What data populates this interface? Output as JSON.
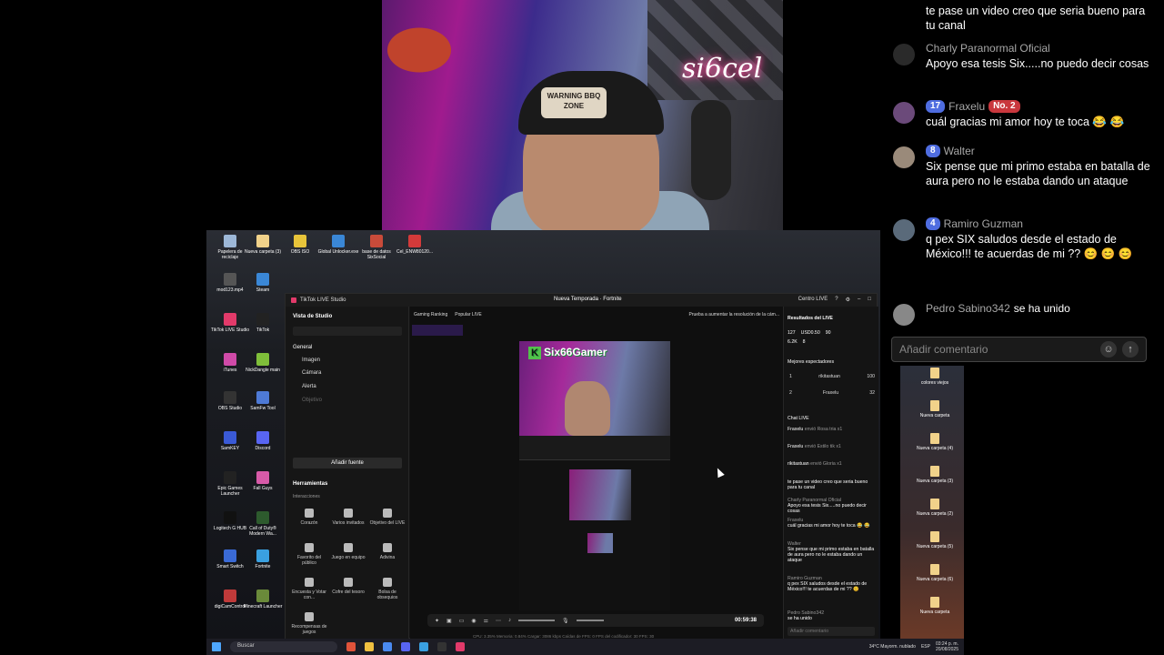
{
  "webcam": {
    "cap_text": "WARNING BBQ ZONE",
    "neon_text": "si6cel"
  },
  "chat_overlay": {
    "top_partial": "te pase un video creo que seria bueno para tu canal",
    "messages": [
      {
        "name": "Charly Paranormal Oficial",
        "text": "Apoyo esa tesis Six.....no puedo decir cosas",
        "badges": []
      },
      {
        "name": "Fraxelu",
        "badge_num": "17",
        "badge_rank": "No. 2",
        "text": "cuál gracias mi amor hoy te toca 😂 😂"
      },
      {
        "name": "Walter",
        "badge_num": "8",
        "text": "Six pense que mi primo estaba en batalla de aura pero no le estaba dando un ataque"
      },
      {
        "name": "Ramiro Guzman",
        "badge_num": "4",
        "text": "q pex SIX saludos desde el estado de México!!! te acuerdas de mi ?? 😊 😊 😊"
      }
    ],
    "join_notice": {
      "name": "Pedro Sabino342",
      "text": "se ha unido"
    },
    "comment_placeholder": "Añadir comentario"
  },
  "desktop_icons": [
    {
      "label": "Papelera de reciclaje",
      "color": "#9db8d8"
    },
    {
      "label": "Nueva carpeta (3)",
      "color": "#f1d28a"
    },
    {
      "label": "OBS ISO",
      "color": "#e8c43a"
    },
    {
      "label": "Global Unlocker.exe",
      "color": "#3a87d6"
    },
    {
      "label": "base de datos SixSocial",
      "color": "#c94b3a"
    },
    {
      "label": "Cel_ENW80120...",
      "color": "#d43a3a"
    },
    {
      "label": "mod123.mp4",
      "color": "#555"
    },
    {
      "label": "Steam",
      "color": "#3a87d6"
    },
    {
      "label": "TikTok LIVE Studio",
      "color": "#e23a6a"
    },
    {
      "label": "TikTok",
      "color": "#222"
    },
    {
      "label": "iTunes",
      "color": "#d04aa8"
    },
    {
      "label": "NickDangle main",
      "color": "#7fbf3a"
    },
    {
      "label": "OBS Studio",
      "color": "#333"
    },
    {
      "label": "SamFw Tool",
      "color": "#4e7ad6"
    },
    {
      "label": "SamKEY",
      "color": "#3a5ad6"
    },
    {
      "label": "Discord",
      "color": "#5865f2"
    },
    {
      "label": "Epic Games Launcher",
      "color": "#222"
    },
    {
      "label": "Fall Guys",
      "color": "#d75aa8"
    },
    {
      "label": "Logitech G HUB",
      "color": "#111"
    },
    {
      "label": "Call of Duty® Modern Wa...",
      "color": "#2d5a2d"
    },
    {
      "label": "Smart Switch",
      "color": "#3a6ad6"
    },
    {
      "label": "Fortnite",
      "color": "#3aa0e0"
    },
    {
      "label": "digiCamControl",
      "color": "#c03a3a"
    },
    {
      "label": "Minecraft Launcher",
      "color": "#6a8a3a"
    }
  ],
  "desktop_right_icons": [
    {
      "label": "colores viejos"
    },
    {
      "label": "Nueva carpeta"
    },
    {
      "label": "Nueva carpeta (4)"
    },
    {
      "label": "Nueva carpeta (3)"
    },
    {
      "label": "Nueva carpeta (2)"
    },
    {
      "label": "Nueva carpeta (5)"
    },
    {
      "label": "Nueva carpeta (6)"
    },
    {
      "label": "Nueva carpeta"
    }
  ],
  "studio": {
    "app_title": "TikTok LIVE Studio",
    "stream_title": "Nueva Temporada · Fortnite",
    "top_right": "Centro LIVE",
    "left": {
      "view_label": "Vista de Studio",
      "scene_general": "General",
      "sources": [
        "Imagen",
        "Cámara",
        "Alerta",
        "Objetivo"
      ],
      "add_source": "Añadir fuente",
      "tools_header": "Herramientas",
      "interaction": "Interacciones",
      "tools": [
        "Corazón",
        "Varios invitados",
        "Objetivo del LIVE",
        "Favorito del público",
        "Juego en equipo",
        "Adivina",
        "Encuesta y Votar con...",
        "Cofre del tesoro",
        "Bolsa de obsequios",
        "Recompensas de juegos"
      ]
    },
    "center": {
      "chips": [
        "Gaming Ranking",
        "Popular LIVE"
      ],
      "hint": "Prueba a aumentar la resolución de la cám...",
      "preview_title": "Six66Gamer",
      "timer": "00:59:38"
    },
    "status_bar": "CPU: 3.35%   Memoria: 0.84%   Cargar: 3086 kbps   Caídas de FPS: 0   FPS del codificador: 30   FPS: 30",
    "right": {
      "results_header": "Resultados del LIVE",
      "stats": {
        "viewers": "127",
        "money": "USD0.50",
        "likes": "90",
        "hearts": "6.2K",
        "comments": "8"
      },
      "top_viewers_header": "Mejores espectadores",
      "top_viewers": [
        {
          "rank": "1",
          "name": "rikitastuan",
          "score": "100"
        },
        {
          "rank": "2",
          "name": "Fraxelu",
          "score": "32"
        }
      ],
      "chat_header": "Chat LIVE",
      "gifts": [
        {
          "name": "Fraxelu",
          "text": "envió Rosa tria x1"
        },
        {
          "name": "Fraxelu",
          "text": "envió Estilo tik x1"
        },
        {
          "name": "rikitastuan",
          "text": "envió Gloria x1"
        }
      ],
      "messages": [
        {
          "text": "te pase un video creo que seria bueno para tu canal"
        },
        {
          "name": "Charly Paranormal Oficial",
          "text": "Apoyo esa tesis Six.....no puedo decir cosas"
        },
        {
          "name": "Fraxelu",
          "text": "cuál gracias mi amor hoy te toca 😂 😂"
        },
        {
          "name": "Walter",
          "text": "Six pense que mi primo estaba en batalla de aura pero no le estaba dando un ataque"
        },
        {
          "name": "Ramiro Guzman",
          "text": "q pex SIX saludos desde el estado de México!!! te acuerdas de mi ?? 😊"
        },
        {
          "name": "Pedro Sabino342",
          "text": "se ha unido"
        }
      ],
      "comment_placeholder": "Añadir comentario"
    }
  },
  "taskbar": {
    "search": "Buscar",
    "weather": "34°C  Mayorm. nublado",
    "lang": "ESP",
    "time": "03:24 p. m.",
    "date": "20/08/2025"
  }
}
